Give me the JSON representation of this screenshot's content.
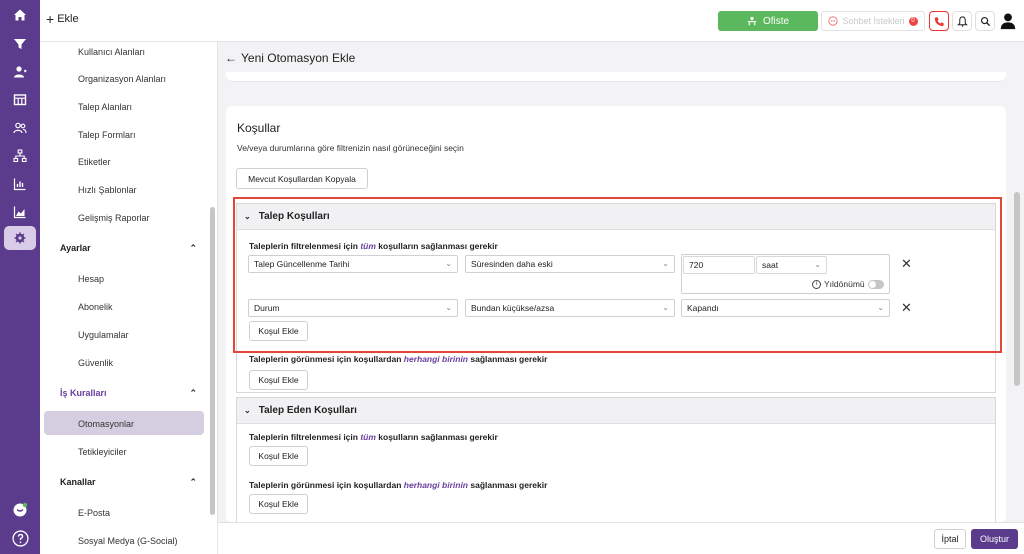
{
  "topbar": {
    "add_label": "Ekle",
    "ofiste_label": "Ofiste",
    "sohbet_label": "Sohbet İstekleri",
    "sohbet_count": "0"
  },
  "sidebar": {
    "items_top": [
      {
        "label": "Kullanıcı Alanları"
      },
      {
        "label": "Organizasyon Alanları"
      },
      {
        "label": "Talep Alanları"
      },
      {
        "label": "Talep Formları"
      },
      {
        "label": "Etiketler"
      },
      {
        "label": "Hızlı Şablonlar"
      },
      {
        "label": "Gelişmiş Raporlar"
      }
    ],
    "ayarlar": {
      "label": "Ayarlar",
      "items": [
        {
          "label": "Hesap"
        },
        {
          "label": "Abonelik"
        },
        {
          "label": "Uygulamalar"
        },
        {
          "label": "Güvenlik"
        }
      ]
    },
    "is_kurallari": {
      "label": "İş Kuralları",
      "items": [
        {
          "label": "Otomasyonlar"
        },
        {
          "label": "Tetikleyiciler"
        }
      ]
    },
    "kanallar": {
      "label": "Kanallar",
      "items": [
        {
          "label": "E-Posta"
        },
        {
          "label": "Sosyal Medya (G-Social)"
        }
      ]
    }
  },
  "page": {
    "title": "Yeni Otomasyon Ekle"
  },
  "conditions": {
    "title": "Koşullar",
    "description": "Ve/veya durumlarına göre filtrenizin nasıl görüneceğini seçin",
    "copy_button": "Mevcut Koşullardan Kopyala",
    "talep": {
      "title": "Talep Koşulları",
      "all_prefix": "Taleplerin filtrelenmesi için ",
      "all_em": "tüm",
      "all_suffix": " koşulların sağlanması gerekir",
      "rows": [
        {
          "field": "Talep Güncellenme Tarihi",
          "operator": "Süresinden daha eski",
          "value": "720",
          "unit": "saat",
          "anniversary_label": "Yıldönümü"
        },
        {
          "field": "Durum",
          "operator": "Bundan küçükse/azsa",
          "value": "Kapandı"
        }
      ],
      "add_all": "Koşul Ekle",
      "any_prefix": "Taleplerin görünmesi için koşullardan ",
      "any_em": "herhangi birinin",
      "any_suffix": " sağlanması gerekir",
      "add_any": "Koşul Ekle"
    },
    "requester": {
      "title": "Talep Eden Koşulları",
      "all_prefix": "Taleplerin filtrelenmesi için ",
      "all_em": "tüm",
      "all_suffix": " koşulların sağlanması gerekir",
      "add_all": "Koşul Ekle",
      "any_prefix": "Taleplerin görünmesi için koşullardan ",
      "any_em": "herhangi birinin",
      "any_suffix": " sağlanması gerekir",
      "add_any": "Koşul Ekle"
    }
  },
  "footer": {
    "cancel": "İptal",
    "create": "Oluştur"
  },
  "colors": {
    "rail": "#5b3b8c",
    "accent": "#6a3ea0",
    "ofiste": "#5cb85c",
    "highlight": "#e0463a"
  }
}
